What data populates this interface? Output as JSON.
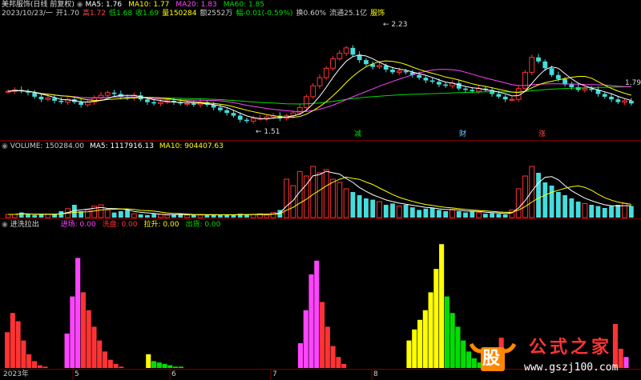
{
  "header": {
    "stock_name": "美邦服饰(日线 前复权)",
    "ma_items": [
      {
        "label": "MA5: 1.76",
        "color": "#ffffff"
      },
      {
        "label": "MA10: 1.77",
        "color": "#ffff00"
      },
      {
        "label": "MA20: 1.83",
        "color": "#ff44ff"
      },
      {
        "label": "MA60: 1.85",
        "color": "#00dd00"
      }
    ],
    "quote_items": [
      {
        "label": "2023/10/23/一",
        "color": "#cccccc"
      },
      {
        "label": "开1.70",
        "color": "#cccccc"
      },
      {
        "label": "高1.72",
        "color": "#ff4444"
      },
      {
        "label": "低1.68",
        "color": "#00dd00"
      },
      {
        "label": "收1.69",
        "color": "#00dd00"
      },
      {
        "label": "量150284",
        "color": "#ffff00"
      },
      {
        "label": "额2552万",
        "color": "#cccccc"
      },
      {
        "label": "幅-0.01(-0.59%)",
        "color": "#00dd00"
      },
      {
        "label": "换0.60%",
        "color": "#cccccc"
      },
      {
        "label": "流通25.1亿",
        "color": "#cccccc"
      },
      {
        "label": "服饰",
        "color": "#ffff00"
      }
    ]
  },
  "price_panel": {
    "high_annotation": "2.23",
    "low_annotation": "1.51",
    "right_price_label": "1.79",
    "event_markers": [
      {
        "text": "减",
        "color": "#00dd00"
      },
      {
        "text": "财",
        "color": "#66ccff"
      },
      {
        "text": "涨",
        "color": "#ff4444"
      }
    ]
  },
  "volume_panel": {
    "items": [
      {
        "label": "VOLUME: 150284.00",
        "color": "#cccccc"
      },
      {
        "label": "MA5: 1117916.13",
        "color": "#ffffff"
      },
      {
        "label": "MA10: 904407.63",
        "color": "#ffff00"
      }
    ]
  },
  "indicator_panel": {
    "name": "进洗拉出",
    "items": [
      {
        "label": "进场: 0.00",
        "color": "#ff44ff"
      },
      {
        "label": "洗盘: 0.00",
        "color": "#ff3333"
      },
      {
        "label": "拉升: 0.00",
        "color": "#ffff00"
      },
      {
        "label": "出货: 0.00",
        "color": "#00dd00"
      }
    ]
  },
  "x_axis": {
    "labels": [
      "2023年",
      "5",
      "6",
      "7",
      "8"
    ]
  },
  "watermark": {
    "logo_char": "股",
    "text": "公式之家",
    "url": "www.gszj100.com"
  },
  "chart_data": {
    "type": "bar",
    "title": "",
    "price_ylim": [
      1.45,
      2.3
    ],
    "price_high": 2.23,
    "price_low": 1.51,
    "price_current": 1.69,
    "close_path": [
      1.78,
      1.79,
      1.78,
      1.77,
      1.74,
      1.72,
      1.73,
      1.71,
      1.7,
      1.72,
      1.7,
      1.68,
      1.7,
      1.73,
      1.75,
      1.77,
      1.76,
      1.74,
      1.73,
      1.75,
      1.72,
      1.7,
      1.69,
      1.7,
      1.71,
      1.7,
      1.69,
      1.69,
      1.68,
      1.7,
      1.68,
      1.66,
      1.64,
      1.62,
      1.6,
      1.57,
      1.56,
      1.58,
      1.58,
      1.59,
      1.6,
      1.58,
      1.6,
      1.62,
      1.66,
      1.74,
      1.82,
      1.88,
      1.95,
      2.02,
      2.06,
      2.1,
      2.05,
      2.01,
      1.98,
      1.96,
      1.97,
      1.94,
      1.92,
      1.93,
      1.92,
      1.9,
      1.88,
      1.86,
      1.85,
      1.83,
      1.82,
      1.84,
      1.8,
      1.79,
      1.78,
      1.8,
      1.79,
      1.76,
      1.74,
      1.72,
      1.72,
      1.8,
      1.92,
      2.03,
      2.0,
      1.95,
      1.9,
      1.87,
      1.83,
      1.81,
      1.79,
      1.8,
      1.79,
      1.76,
      1.74,
      1.72,
      1.7,
      1.71,
      1.69
    ],
    "volume_path": [
      0.05,
      0.05,
      0.08,
      0.05,
      0.04,
      0.05,
      0.05,
      0.06,
      0.1,
      0.14,
      0.2,
      0.1,
      0.12,
      0.18,
      0.2,
      0.12,
      0.08,
      0.1,
      0.12,
      0.06,
      0.05,
      0.04,
      0.06,
      0.05,
      0.04,
      0.05,
      0.05,
      0.04,
      0.05,
      0.04,
      0.04,
      0.05,
      0.04,
      0.05,
      0.04,
      0.06,
      0.05,
      0.05,
      0.06,
      0.04,
      0.08,
      0.12,
      0.6,
      0.5,
      0.72,
      0.65,
      0.8,
      0.7,
      0.75,
      0.6,
      0.55,
      0.45,
      0.4,
      0.35,
      0.3,
      0.28,
      0.25,
      0.2,
      0.22,
      0.18,
      0.2,
      0.16,
      0.12,
      0.14,
      0.15,
      0.12,
      0.1,
      0.12,
      0.1,
      0.08,
      0.1,
      0.08,
      0.06,
      0.07,
      0.06,
      0.05,
      0.12,
      0.45,
      0.65,
      0.8,
      0.7,
      0.55,
      0.5,
      0.4,
      0.35,
      0.3,
      0.25,
      0.22,
      0.2,
      0.18,
      0.15,
      0.18,
      0.2,
      0.22,
      0.18
    ],
    "indicator_bars": [
      {
        "v": 0.26,
        "c": "#ff3333"
      },
      {
        "v": 0.4,
        "c": "#ff3333"
      },
      {
        "v": 0.34,
        "c": "#ff3333"
      },
      {
        "v": 0.2,
        "c": "#ff3333"
      },
      {
        "v": 0.1,
        "c": "#ff3333"
      },
      {
        "v": 0.05,
        "c": "#ff3333"
      },
      {
        "v": 0.02,
        "c": "#ff3333"
      },
      {
        "v": 0.01,
        "c": "#ff3333"
      },
      {
        "v": 0,
        "c": "#000"
      },
      {
        "v": 0,
        "c": "#000"
      },
      {
        "v": 0.25,
        "c": "#ff44ff"
      },
      {
        "v": 0.52,
        "c": "#ff44ff"
      },
      {
        "v": 0.8,
        "c": "#ff44ff"
      },
      {
        "v": 0.55,
        "c": "#ff3333"
      },
      {
        "v": 0.42,
        "c": "#ff3333"
      },
      {
        "v": 0.3,
        "c": "#ff3333"
      },
      {
        "v": 0.2,
        "c": "#ff3333"
      },
      {
        "v": 0.12,
        "c": "#ff3333"
      },
      {
        "v": 0.06,
        "c": "#ff3333"
      },
      {
        "v": 0.03,
        "c": "#ff3333"
      },
      {
        "v": 0.01,
        "c": "#ff3333"
      },
      {
        "v": 0.1,
        "c": "#ffff00"
      },
      {
        "v": 0.05,
        "c": "#00dd00"
      },
      {
        "v": 0.04,
        "c": "#00dd00"
      },
      {
        "v": 0.03,
        "c": "#00dd00"
      },
      {
        "v": 0.02,
        "c": "#00dd00"
      },
      {
        "v": 0.01,
        "c": "#00dd00"
      },
      {
        "v": 0.01,
        "c": "#00dd00"
      },
      {
        "v": 0,
        "c": "#000"
      },
      {
        "v": 0.18,
        "c": "#ff44ff"
      },
      {
        "v": 0.42,
        "c": "#ff44ff"
      },
      {
        "v": 0.68,
        "c": "#ff44ff"
      },
      {
        "v": 0.78,
        "c": "#ff44ff"
      },
      {
        "v": 0.48,
        "c": "#ff3333"
      },
      {
        "v": 0.3,
        "c": "#ff3333"
      },
      {
        "v": 0.16,
        "c": "#ff3333"
      },
      {
        "v": 0.08,
        "c": "#ff3333"
      },
      {
        "v": 0.03,
        "c": "#ff3333"
      },
      {
        "v": 0,
        "c": "#000"
      },
      {
        "v": 0.2,
        "c": "#ffff00"
      },
      {
        "v": 0.28,
        "c": "#ffff00"
      },
      {
        "v": 0.35,
        "c": "#ffff00"
      },
      {
        "v": 0.42,
        "c": "#ffff00"
      },
      {
        "v": 0.55,
        "c": "#ffff00"
      },
      {
        "v": 0.72,
        "c": "#ffff00"
      },
      {
        "v": 0.9,
        "c": "#ffff00"
      },
      {
        "v": 0.52,
        "c": "#00dd00"
      },
      {
        "v": 0.4,
        "c": "#00dd00"
      },
      {
        "v": 0.3,
        "c": "#00dd00"
      },
      {
        "v": 0.2,
        "c": "#00dd00"
      },
      {
        "v": 0.12,
        "c": "#00dd00"
      },
      {
        "v": 0.07,
        "c": "#00dd00"
      },
      {
        "v": 0.04,
        "c": "#00dd00"
      },
      {
        "v": 0.02,
        "c": "#00dd00"
      },
      {
        "v": 0.01,
        "c": "#00dd00"
      },
      {
        "v": 0,
        "c": "#000"
      },
      {
        "v": 0.22,
        "c": "#ff3333"
      },
      {
        "v": 0.32,
        "c": "#ff3333"
      },
      {
        "v": 0.14,
        "c": "#ff3333"
      },
      {
        "v": 0.08,
        "c": "#ff44ff"
      }
    ]
  }
}
